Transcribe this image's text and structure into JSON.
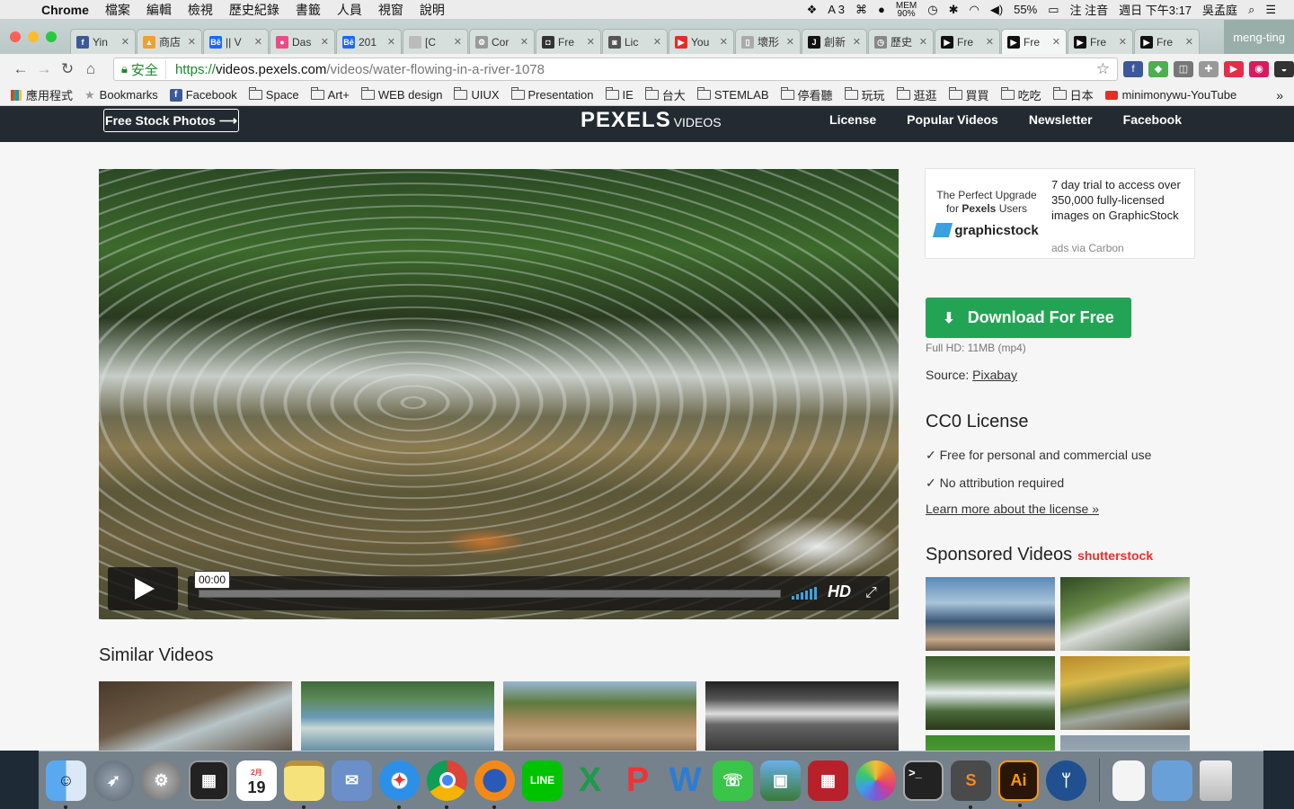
{
  "menubar": {
    "app": "Chrome",
    "items": [
      "檔案",
      "編輯",
      "檢視",
      "歷史紀錄",
      "書籤",
      "人員",
      "視窗",
      "說明"
    ],
    "status": {
      "adobe_count": "3",
      "mem_label": "MEM",
      "mem_value": "90%",
      "battery": "55%",
      "input_method": "注音",
      "datetime": "週日 下午3:17",
      "user": "吳孟庭"
    }
  },
  "tabstrip": {
    "tabs": [
      {
        "icon": "facebook-icon",
        "title": "Yin",
        "color": "#3b5998",
        "glyph": "f"
      },
      {
        "icon": "shop-icon",
        "title": "商店",
        "color": "#f0a030",
        "glyph": "▲"
      },
      {
        "icon": "behance-icon",
        "title": "|| V",
        "color": "#1769ff",
        "glyph": "Bē"
      },
      {
        "icon": "dribbble-icon",
        "title": "Das",
        "color": "#ea4c89",
        "glyph": "●"
      },
      {
        "icon": "behance-icon",
        "title": "201",
        "color": "#1769ff",
        "glyph": "Bē"
      },
      {
        "icon": "page-icon",
        "title": "[C",
        "color": "#bbb",
        "glyph": ""
      },
      {
        "icon": "settings-icon",
        "title": "Cor",
        "color": "#999",
        "glyph": "⚙"
      },
      {
        "icon": "instagram-icon",
        "title": "Fre",
        "color": "#333",
        "glyph": "◘"
      },
      {
        "icon": "camera-icon",
        "title": "Lic",
        "color": "#555",
        "glyph": "◙"
      },
      {
        "icon": "youtube-icon",
        "title": "You",
        "color": "#e52d27",
        "glyph": "▶"
      },
      {
        "icon": "doc-icon",
        "title": "壞形",
        "color": "#aaa",
        "glyph": "▯"
      },
      {
        "icon": "j-icon",
        "title": "創新",
        "color": "#111",
        "glyph": "J"
      },
      {
        "icon": "history-icon",
        "title": "歷史",
        "color": "#888",
        "glyph": "◷"
      },
      {
        "icon": "video-icon",
        "title": "Fre",
        "color": "#111",
        "glyph": "▶"
      },
      {
        "icon": "video-icon",
        "title": "Fre",
        "color": "#111",
        "glyph": "▶",
        "active": true
      },
      {
        "icon": "video-icon",
        "title": "Fre",
        "color": "#111",
        "glyph": "▶"
      },
      {
        "icon": "video-icon",
        "title": "Fre",
        "color": "#111",
        "glyph": "▶"
      }
    ],
    "profile": "meng-ting"
  },
  "toolbar": {
    "secure_label": "安全",
    "url_proto": "https://",
    "url_host": "videos.pexels.com",
    "url_path": "/videos/water-flowing-in-a-river-1078"
  },
  "bookmarks": {
    "apps_label": "應用程式",
    "items": [
      "Bookmarks",
      "Facebook",
      "Space",
      "Art+",
      "WEB design",
      "UIUX",
      "Presentation",
      "IE",
      "台大",
      "STEMLAB",
      "停看聽",
      "玩玩",
      "逛逛",
      "買買",
      "吃吃",
      "日本",
      "minimonywu-YouTube"
    ],
    "more": "»"
  },
  "page": {
    "nav": {
      "free_stock_label": "Free Stock Photos ⟶",
      "logo_main": "PEXELS",
      "logo_sub": "VIDEOS",
      "links": [
        "License",
        "Popular Videos",
        "Newsletter",
        "Facebook"
      ]
    },
    "player": {
      "time": "00:00",
      "hd_label": "HD",
      "progress": 0.0
    },
    "similar_title": "Similar Videos",
    "ad": {
      "tagline_a": "The Perfect Upgrade for",
      "tagline_brand": "Pexels",
      "tagline_b": "Users",
      "brand": "graphicstock",
      "text": "7 day trial to access over 350,000 fully-licensed images on GraphicStock",
      "via": "ads via Carbon"
    },
    "download": {
      "label": "Download For Free",
      "meta": "Full HD: 11MB (mp4)",
      "source_label": "Source:",
      "source_link": "Pixabay"
    },
    "license": {
      "title": "CC0 License",
      "items": [
        "✓ Free for personal and commercial use",
        "✓ No attribution required"
      ],
      "learn_more": "Learn more about the license »"
    },
    "sponsored": {
      "title": "Sponsored Videos",
      "brand": "shutterstock"
    }
  },
  "dock": {
    "apps": [
      "finder-icon",
      "launchpad-icon",
      "system-preferences-icon",
      "activity-icon",
      "calendar-icon",
      "notes-icon",
      "preview-icon",
      "safari-icon",
      "chrome-icon",
      "firefox-icon",
      "line-icon",
      "excel-icon",
      "powerpoint-icon",
      "word-icon",
      "facetime-icon",
      "photo-booth-icon",
      "photo-icon",
      "photos-icon",
      "terminal-icon",
      "sublime-icon",
      "illustrator-icon",
      "sourcetree-icon"
    ],
    "calendar_day": "19",
    "calendar_month": "2月"
  }
}
